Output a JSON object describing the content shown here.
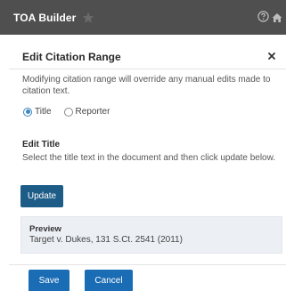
{
  "header": {
    "title": "TOA Builder",
    "favorite_icon": "star-icon",
    "help_icon": "help-icon",
    "home_icon": "home-icon",
    "background_color": "#4f4f4f"
  },
  "dialog": {
    "title": "Edit Citation Range",
    "close_icon": "close-icon",
    "warning": "Modifying citation range will override any manual edits made to citation text.",
    "radio_options": [
      {
        "label": "Title",
        "checked": true
      },
      {
        "label": "Reporter",
        "checked": false
      }
    ],
    "edit_section": {
      "title": "Edit Title",
      "instructions": "Select the title text in the document and then click update below.",
      "update_label": "Update"
    },
    "preview": {
      "label": "Preview",
      "text": "Target v. Dukes, 131 S.Ct. 2541 (2011)"
    },
    "actions": {
      "save_label": "Save",
      "cancel_label": "Cancel"
    },
    "accent_color": "#1a6cb5"
  }
}
